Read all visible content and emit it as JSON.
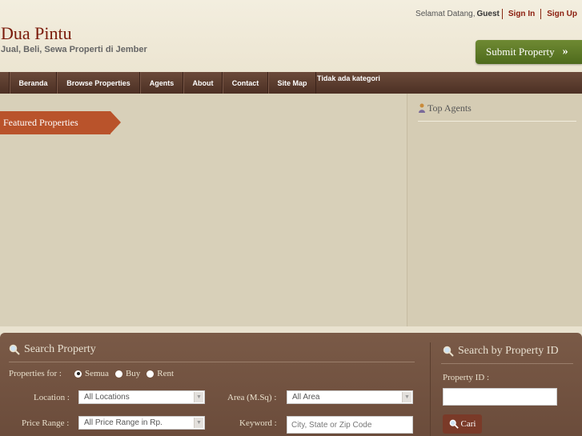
{
  "header": {
    "greeting": "Selamat Datang,",
    "guest": "Guest",
    "sign_in": "Sign In",
    "sign_up": "Sign Up",
    "site_title": "Dua Pintu",
    "tagline": "Jual, Beli, Sewa Properti di Jember",
    "submit_label": "Submit Property"
  },
  "nav": {
    "items": [
      {
        "label": "Beranda"
      },
      {
        "label": "Browse Properties"
      },
      {
        "label": "Agents"
      },
      {
        "label": "About"
      },
      {
        "label": "Contact"
      },
      {
        "label": "Site Map"
      }
    ],
    "category_text": "Tidak ada kategori"
  },
  "main": {
    "featured_label": "Featured Properties"
  },
  "sidebar": {
    "top_agents_label": "Top Agents"
  },
  "search": {
    "title": "Search Property",
    "properties_for_label": "Properties for :",
    "radio_options": [
      "Semua",
      "Buy",
      "Rent"
    ],
    "location_label": "Location :",
    "location_value": "All Locations",
    "area_label": "Area (M.Sq) :",
    "area_value": "All Area",
    "price_label": "Price Range :",
    "price_value": "All Price Range in Rp.",
    "keyword_label": "Keyword :",
    "keyword_placeholder": "City, State or Zip Code",
    "id_title": "Search by Property ID",
    "id_label": "Property ID :",
    "cari_label": "Cari"
  },
  "colors": {
    "brand": "#7a1a0a",
    "nav_bg": "#5a3b2d",
    "featured_tab": "#b9532b",
    "submit_green": "#5e7a28",
    "search_bg": "#704f3e"
  }
}
